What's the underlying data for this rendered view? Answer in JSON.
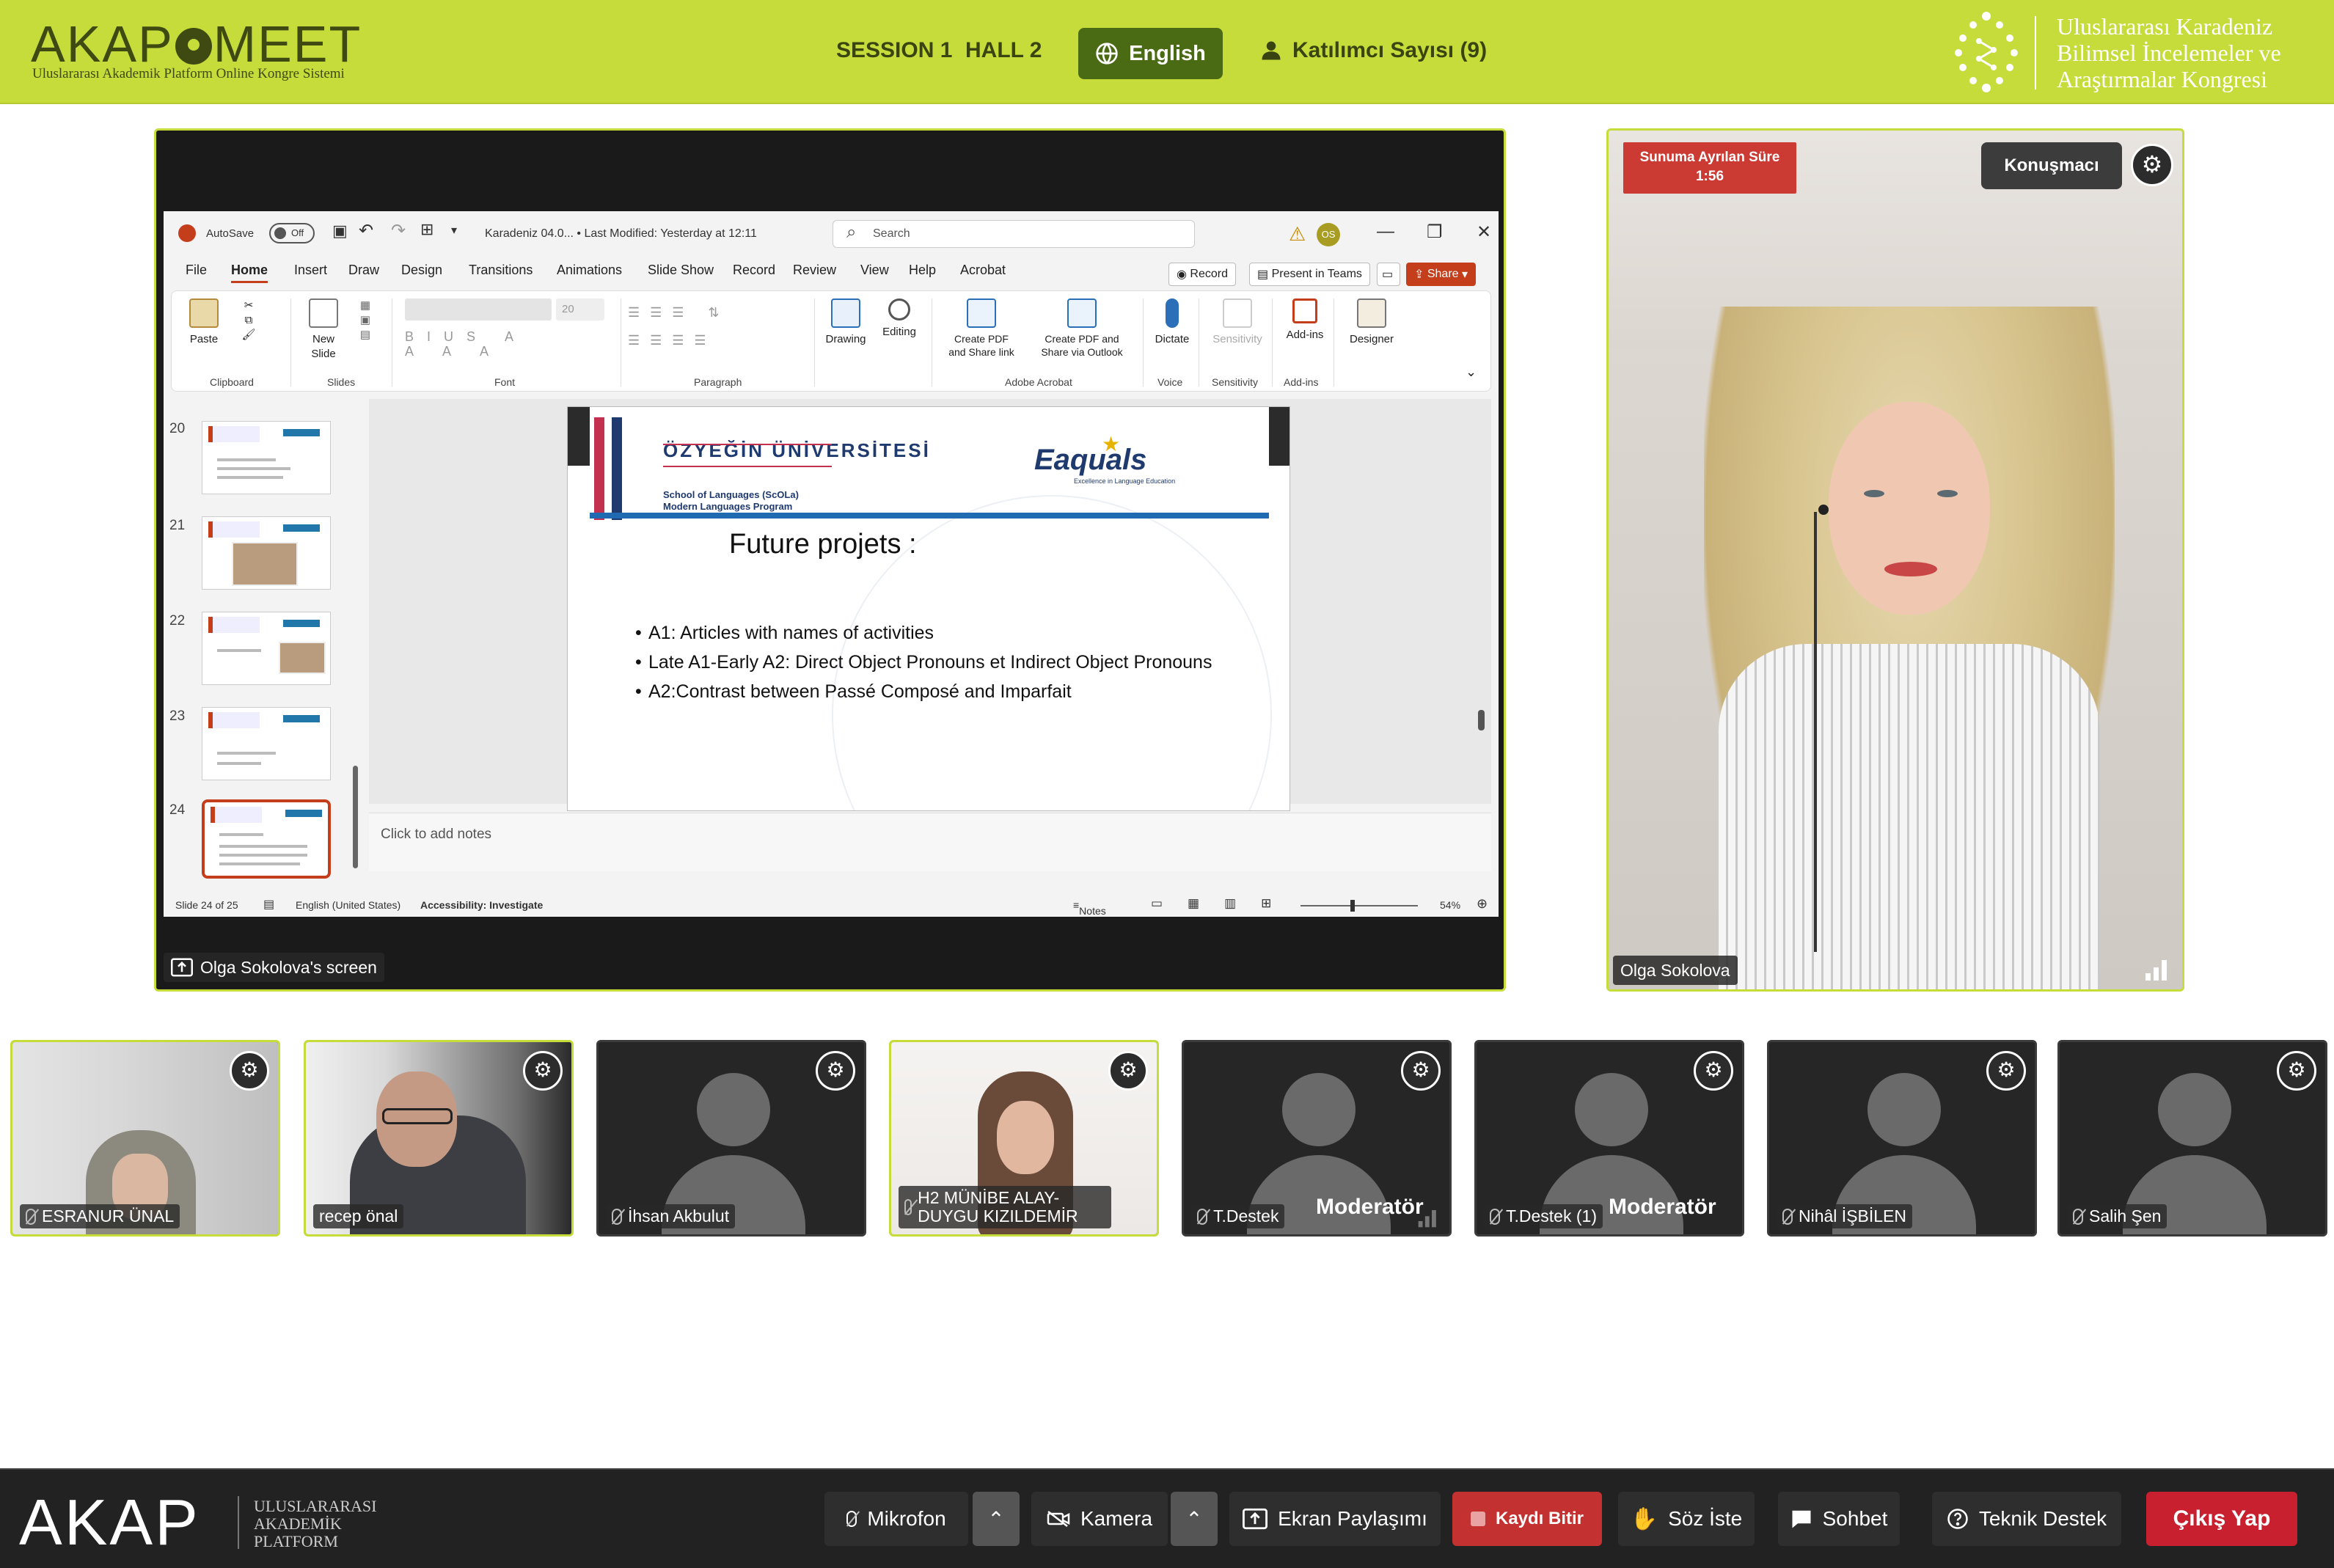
{
  "header": {
    "logo_text_left": "AKAP",
    "logo_text_right": "MEET",
    "logo_subtitle": "Uluslararası Akademik Platform Online Kongre Sistemi",
    "session": "SESSION 1",
    "hall": "HALL 2",
    "language_button": "English",
    "participants": "Katılımcı Sayısı (9)",
    "congress_title": [
      "Uluslararası Karadeniz",
      "Bilimsel İncelemeler ve",
      "Araştırmalar Kongresi"
    ]
  },
  "share": {
    "label": "Olga Sokolova's screen",
    "powerpoint": {
      "autosave": "AutoSave",
      "toggle": "Off",
      "file_title": "Karadeniz 04.0...  •  Last Modified: Yesterday at 12:11",
      "search_placeholder": "Search",
      "avatar_initials": "OS",
      "tabs": [
        "File",
        "Home",
        "Insert",
        "Draw",
        "Design",
        "Transitions",
        "Animations",
        "Slide Show",
        "Record",
        "Review",
        "View",
        "Help",
        "Acrobat"
      ],
      "record_button": "Record",
      "present_button": "Present in Teams",
      "share_button": "Share",
      "ribbon": {
        "paste": "Paste",
        "new_slide": [
          "New",
          "Slide"
        ],
        "font_size": "20",
        "drawing": "Drawing",
        "editing": "Editing",
        "create_pdf_share": [
          "Create PDF",
          "and Share link"
        ],
        "create_pdf_outlook": [
          "Create PDF and",
          "Share via Outlook"
        ],
        "dictate": "Dictate",
        "sensitivity": "Sensitivity",
        "addins": "Add-ins",
        "designer": "Designer",
        "group_labels": [
          "Clipboard",
          "Slides",
          "Font",
          "Paragraph",
          "Adobe Acrobat",
          "Voice",
          "Sensitivity",
          "Add-ins"
        ]
      },
      "thumbnails": [
        "20",
        "21",
        "22",
        "23",
        "24"
      ],
      "slide": {
        "university": "ÖZYEĞİN ÜNİVERSİTESİ",
        "school_line1": "School of Languages (ScOLa)",
        "school_line2": "Modern Languages Program",
        "eaquals": "Eaquals",
        "eaquals_tagline": "Excellence in Language Education",
        "title": "Future projets :",
        "bullets": [
          "A1: Articles with names of activities",
          "Late A1-Early A2: Direct Object Pronouns et Indirect Object Pronouns",
          "A2:Contrast between Passé Composé and Imparfait"
        ]
      },
      "notes_placeholder": "Click to add notes",
      "status": {
        "slide_count": "Slide 24 of 25",
        "language": "English (United States)",
        "accessibility": "Accessibility: Investigate",
        "notes": "Notes",
        "zoom": "54%"
      }
    }
  },
  "speaker": {
    "timer_label": "Sunuma Ayrılan Süre",
    "timer_value": "1:56",
    "role": "Konuşmacı",
    "name": "Olga Sokolova"
  },
  "tiles": [
    {
      "name": "ESRANUR ÜNAL",
      "muted": true,
      "moderator": ""
    },
    {
      "name": "recep önal",
      "muted": false,
      "moderator": ""
    },
    {
      "name": "İhsan Akbulut",
      "muted": true,
      "moderator": ""
    },
    {
      "name": "H2 MÜNİBE ALAY- DUYGU KIZILDEMİR",
      "muted": true,
      "moderator": ""
    },
    {
      "name": "T.Destek",
      "muted": true,
      "moderator": "Moderatör"
    },
    {
      "name": "T.Destek (1)",
      "muted": true,
      "moderator": "Moderatör"
    },
    {
      "name": "Nihâl İŞBİLEN",
      "muted": true,
      "moderator": ""
    },
    {
      "name": "Salih Şen",
      "muted": true,
      "moderator": ""
    }
  ],
  "footer": {
    "logo": "AKAP",
    "logo_text": [
      "ULUSLARARASI",
      "AKADEMİK",
      "PLATFORM"
    ],
    "mic": "Mikrofon",
    "camera": "Kamera",
    "screen_share": "Ekran Paylaşımı",
    "stop_recording": "Kaydı Bitir",
    "raise_hand": "Söz İste",
    "chat": "Sohbet",
    "support": "Teknik Destek",
    "exit": "Çıkış Yap"
  },
  "colors": {
    "brand_green": "#c6dc3b",
    "dark_green": "#4a6b14",
    "recording_red": "#c33131",
    "exit_red": "#c8202f",
    "timer_red": "#cc3b33"
  }
}
